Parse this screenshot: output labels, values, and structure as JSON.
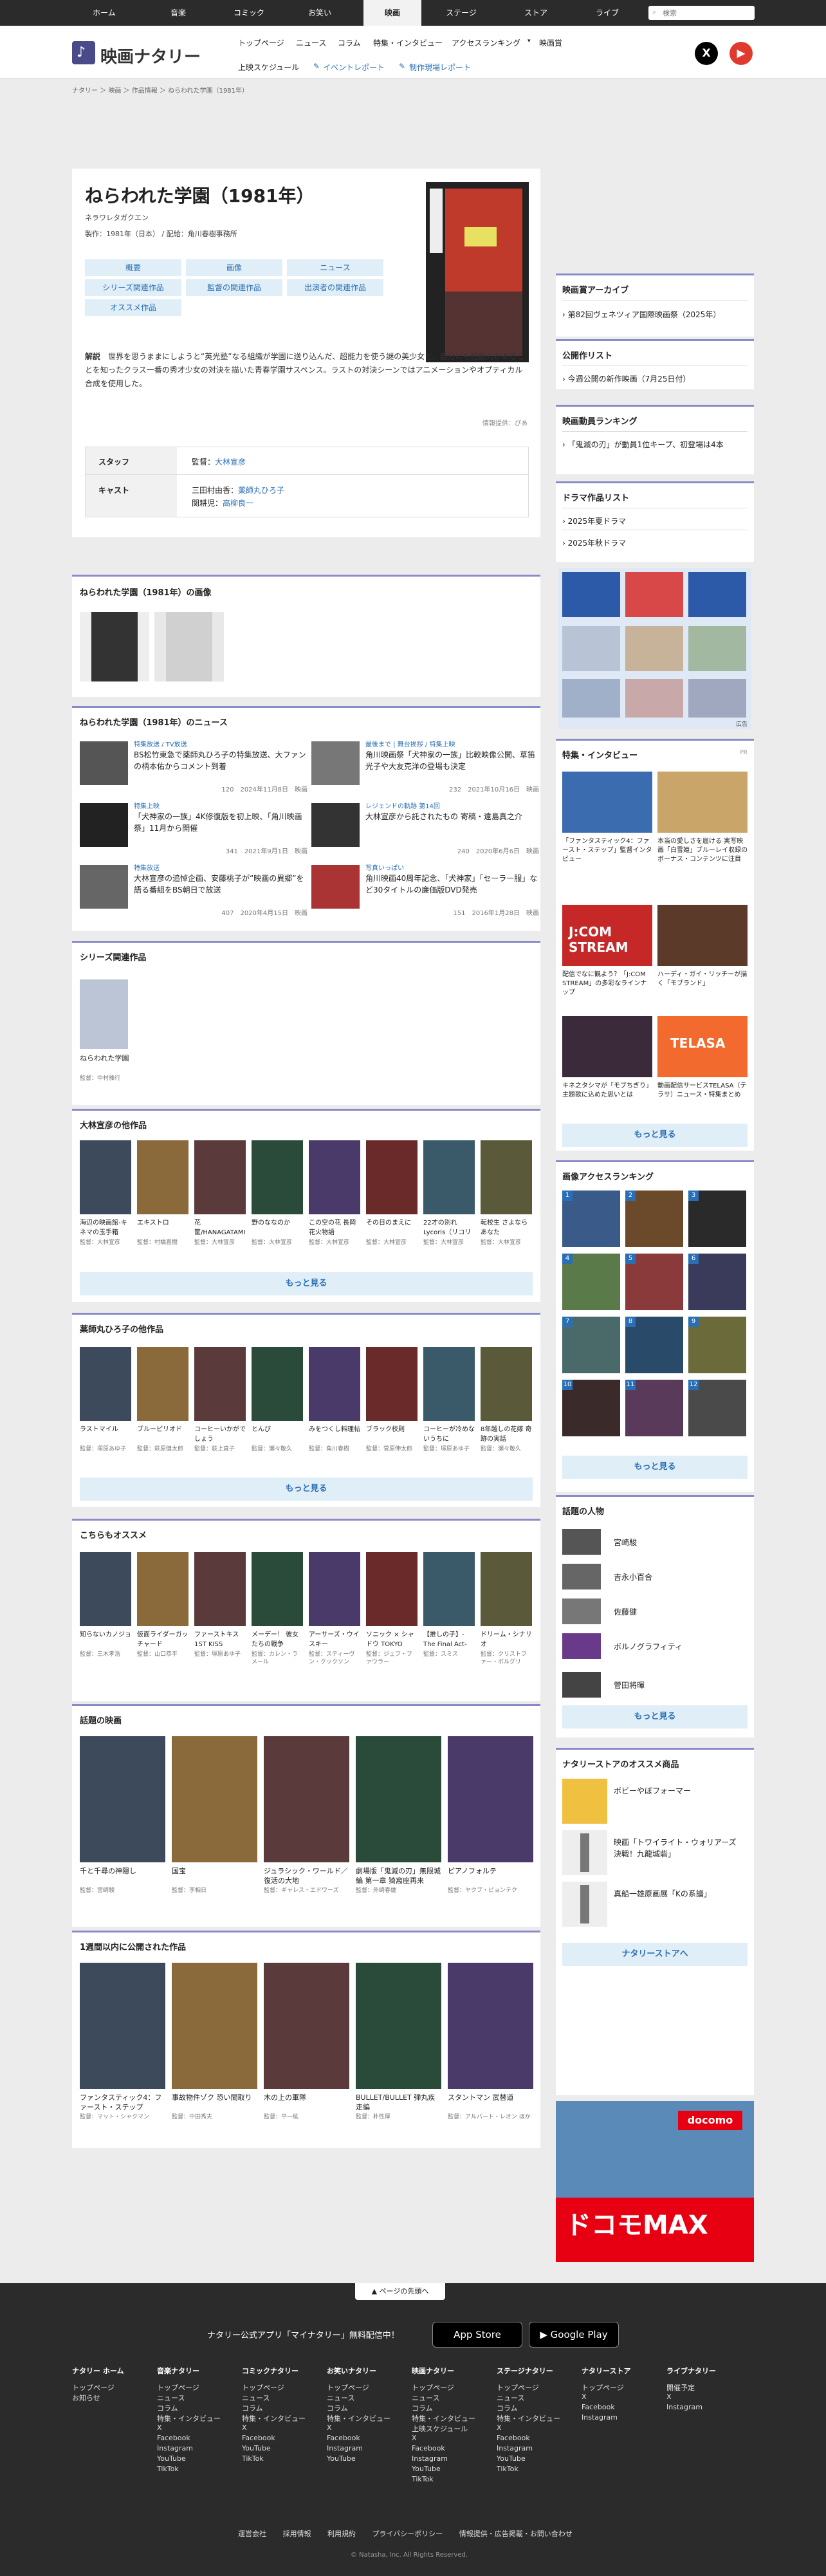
{
  "topnav": {
    "tabs": [
      "ホーム",
      "音楽",
      "コミック",
      "お笑い",
      "映画",
      "ステージ",
      "ストア",
      "ライブ"
    ],
    "active": "映画",
    "search_placeholder": "検索"
  },
  "header": {
    "logo_text": "映画ナタリー",
    "nav": [
      "トップページ",
      "ニュース",
      "コラム",
      "特集・インタビュー",
      "アクセスランキング",
      "映画賞",
      "上映スケジュール",
      "イベントレポート",
      "制作現場レポート"
    ]
  },
  "breadcrumb": [
    "ナタリー",
    "映画",
    "作品情報",
    "ねらわれた学園（1981年）"
  ],
  "movie": {
    "title": "ねらわれた学園（1981年）",
    "kana": "ネラワレタガクエン",
    "meta": "製作：1981年（日本） / 配給：角川春樹事務所",
    "buttons": [
      "概要",
      "画像",
      "ニュース",
      "シリーズ関連作品",
      "監督の関連作品",
      "出演者の関連作品",
      "オススメ作品"
    ],
    "desc_label": "解説",
    "desc": "世界を思うままにしようと“英光塾”なる組織が学園に送り込んだ、超能力を使う謎の美少女と、自分にも超能力があることを知ったクラス一番の秀才少女の対決を描いた青春学園サスペンス。ラストの対決シーンではアニメーションやオプティカル合成を使用した。",
    "source": "情報提供：ぴあ",
    "staff_label": "スタッフ",
    "director_prefix": "監督：",
    "director": "大林宣彦",
    "cast_label": "キャスト",
    "cast": [
      {
        "role": "三田村由香：",
        "name": "薬師丸ひろ子"
      },
      {
        "role": "関耕児：",
        "name": "高柳良一"
      }
    ]
  },
  "images_section": {
    "title": "ねらわれた学園（1981年）の画像"
  },
  "news_section": {
    "title": "ねらわれた学園（1981年）のニュース",
    "items": [
      {
        "cat": "特集放送 / TV放送",
        "title": "BS松竹東急で薬師丸ひろ子の特集放送、大ファンの柄本佑からコメント到着",
        "meta": "120　2024年11月8日　映画"
      },
      {
        "cat": "最後まで | 舞台挨拶 / 特集上映",
        "title": "角川映画祭「犬神家の一族」比較映像公開、草笛光子や大友克洋の登場も決定",
        "meta": "232　2021年10月16日　映画"
      },
      {
        "cat": "特集上映",
        "title": "「犬神家の一族」4K修復版を初上映、「角川映画祭」11月から開催",
        "meta": "341　2021年9月1日　映画"
      },
      {
        "cat": "レジェンドの軌跡 第14回",
        "title": "大林宣彦から託されたもの 寄稿・遠島真之介",
        "meta": "240　2020年6月6日　映画"
      },
      {
        "cat": "特集放送",
        "title": "大林宣彦の追悼企画、安藤桃子が“映画の異郷”を語る番組をBS朝日で放送",
        "meta": "407　2020年4月15日　映画"
      },
      {
        "cat": "写真いっぱい",
        "title": "角川映画40周年記念、「犬神家」「セーラー服」など30タイトルの廉価版DVD発売",
        "meta": "151　2016年1月28日　映画"
      }
    ]
  },
  "series_section": {
    "title": "シリーズ関連作品",
    "items": [
      {
        "title": "ねらわれた学園",
        "sub": "監督：中村雅行"
      }
    ]
  },
  "director_section": {
    "title": "大林宣彦の他作品",
    "items": [
      {
        "title": "海辺の映画館-キネマの玉手箱",
        "sub": "監督：大林宣彦"
      },
      {
        "title": "エキストロ",
        "sub": "監督：村橋直樹"
      },
      {
        "title": "花筐/HANAGATAMI",
        "sub": "監督：大林宣彦"
      },
      {
        "title": "野のななのか",
        "sub": "監督：大林宣彦"
      },
      {
        "title": "この空の花 長岡花火物語",
        "sub": "監督：大林宣彦"
      },
      {
        "title": "その日のまえに",
        "sub": "監督：大林宣彦"
      },
      {
        "title": "22才の別れ Lycoris（リコリス）葉見ず花見ず物語",
        "sub": "監督：大林宣彦"
      },
      {
        "title": "転校生 さよならあなた",
        "sub": "監督：大林宣彦"
      }
    ],
    "more": "もっと見る"
  },
  "actor_section": {
    "title": "薬師丸ひろ子の他作品",
    "items": [
      {
        "title": "ラストマイル",
        "sub": "監督：塚原あゆ子"
      },
      {
        "title": "ブルーピリオド",
        "sub": "監督：萩原健太郎"
      },
      {
        "title": "コーヒーいかがでしょう",
        "sub": "監督：荻上直子"
      },
      {
        "title": "とんび",
        "sub": "監督：瀬々敬久"
      },
      {
        "title": "みをつくし料理帖",
        "sub": "監督：角川春樹"
      },
      {
        "title": "ブラック校則",
        "sub": "監督：菅原伸太郎"
      },
      {
        "title": "コーヒーが冷めないうちに",
        "sub": "監督：塚原あゆ子"
      },
      {
        "title": "8年越しの花嫁 奇跡の実話",
        "sub": "監督：瀬々敬久"
      }
    ],
    "more": "もっと見る"
  },
  "recommend_section": {
    "title": "こちらもオススメ",
    "items": [
      {
        "title": "知らないカノジョ",
        "sub": "監督：三木孝浩"
      },
      {
        "title": "仮面ライダーガッチャード GRADUATIONS",
        "sub": "監督：山口恭平"
      },
      {
        "title": "ファーストキス 1ST KISS",
        "sub": "監督：塚原あゆ子"
      },
      {
        "title": "メーデー！ 彼女たちの戦争",
        "sub": "監督：カレン・ラメール"
      },
      {
        "title": "アーサーズ・ウイスキー",
        "sub": "監督：スティーヴン・クックソン"
      },
      {
        "title": "ソニック × シャドウ TOKYO MISSION",
        "sub": "監督：ジェフ・ファウラー"
      },
      {
        "title": "【推しの子】-The Final Act-",
        "sub": "監督：スミス"
      },
      {
        "title": "ドリーム・シナリオ",
        "sub": "監督：クリストファー・ボルグリ"
      }
    ]
  },
  "hot_section": {
    "title": "話題の映画",
    "items": [
      {
        "title": "千と千尋の神隠し",
        "sub": "監督：宮崎駿"
      },
      {
        "title": "国宝",
        "sub": "監督：李相日"
      },
      {
        "title": "ジュラシック・ワールド／復活の大地",
        "sub": "監督：ギャレス・エドワーズ"
      },
      {
        "title": "劇場版「鬼滅の刃」無限城編 第一章 猗窩座再来",
        "sub": "監督：外崎春雄"
      },
      {
        "title": "ピアノフォルテ",
        "sub": "監督：ヤクブ・ピョンテク"
      }
    ]
  },
  "week_section": {
    "title": "1週間以内に公開された作品",
    "items": [
      {
        "title": "ファンタスティック4：ファースト・ステップ",
        "sub": "監督：マット・シャクマン"
      },
      {
        "title": "事故物件ゾク 恐い間取り",
        "sub": "監督：中田秀夫"
      },
      {
        "title": "木の上の軍隊",
        "sub": "監督：平一紘"
      },
      {
        "title": "BULLET/BULLET 弾丸疾走編",
        "sub": "監督：朴性厚"
      },
      {
        "title": "スタントマン 武替道",
        "sub": "監督：アルバート・レオン ほか"
      }
    ]
  },
  "sidebar": {
    "award": {
      "title": "映画賞アーカイブ",
      "items": [
        "第82回ヴェネツィア国際映画祭（2025年）"
      ]
    },
    "release": {
      "title": "公開作リスト",
      "items": [
        "今週公開の新作映画（7月25日付）"
      ]
    },
    "ranking": {
      "title": "映画動員ランキング",
      "items": [
        "「鬼滅の刃」が動員1位キープ、初登場は4本"
      ]
    },
    "drama": {
      "title": "ドラマ作品リスト",
      "items": [
        "2025年夏ドラマ",
        "2025年秋ドラマ"
      ]
    },
    "ad_note": "広告",
    "features": {
      "title": "特集・インタビュー",
      "pr": "PR",
      "items": [
        "「ファンタスティック4：ファースト・ステップ」監督インタビュー",
        "本当の愛しさを届ける 実写映画「白雪姫」ブルーレイ収録のボーナス・コンテンツに注目",
        "配信でなに観よう？「J:COM STREAM」の多彩なラインナップ",
        "ハーディ・ガイ・リッチーが描く「モブランド」",
        "キネ之タシマが「モブちぎり」主題歌に込めた思いとは",
        "動画配信サービスTELASA（テラサ）ニュース・特集まとめ"
      ],
      "more": "もっと見る"
    },
    "image_ranking": {
      "title": "画像アクセスランキング",
      "more": "もっと見る"
    },
    "people": {
      "title": "話題の人物",
      "items": [
        "宮崎駿",
        "吉永小百合",
        "佐藤健",
        "ボルノグラフィティ",
        "菅田将暉"
      ],
      "more": "もっと見る"
    },
    "store": {
      "title": "ナタリーストアのオススメ商品",
      "items": [
        "ボビーやぼフォーマー",
        "映画「トワイライト・ウォリアーズ 決戦！九龍城砦」",
        "真船一雄原画展「Kの系譜」"
      ],
      "more": "ナタリーストアへ"
    }
  },
  "footer": {
    "back_to_top": "ページの先頭へ",
    "app_text": "ナタリー公式アプリ「マイナタリー」無料配信中！",
    "app_store": "App Store",
    "google_play": "Google Play",
    "columns": [
      {
        "title": "ナタリー ホーム",
        "items": [
          "トップページ",
          "お知らせ"
        ]
      },
      {
        "title": "音楽ナタリー",
        "items": [
          "トップページ",
          "ニュース",
          "コラム",
          "特集・インタビュー",
          "X",
          "Facebook",
          "Instagram",
          "YouTube",
          "TikTok"
        ]
      },
      {
        "title": "コミックナタリー",
        "items": [
          "トップページ",
          "ニュース",
          "コラム",
          "特集・インタビュー",
          "X",
          "Facebook",
          "YouTube",
          "TikTok"
        ]
      },
      {
        "title": "お笑いナタリー",
        "items": [
          "トップページ",
          "ニュース",
          "コラム",
          "特集・インタビュー",
          "X",
          "Facebook",
          "Instagram",
          "YouTube"
        ]
      },
      {
        "title": "映画ナタリー",
        "items": [
          "トップページ",
          "ニュース",
          "コラム",
          "特集・インタビュー",
          "上映スケジュール",
          "X",
          "Facebook",
          "Instagram",
          "YouTube",
          "TikTok"
        ]
      },
      {
        "title": "ステージナタリー",
        "items": [
          "トップページ",
          "ニュース",
          "コラム",
          "特集・インタビュー",
          "X",
          "Facebook",
          "Instagram",
          "YouTube",
          "TikTok"
        ]
      },
      {
        "title": "ナタリーストア",
        "items": [
          "トップページ",
          "X",
          "Facebook",
          "Instagram"
        ]
      },
      {
        "title": "ライブナタリー",
        "items": [
          "開催予定",
          "X",
          "Instagram"
        ]
      }
    ],
    "links": [
      "運営会社",
      "採用情報",
      "利用規約",
      "プライバシーポリシー",
      "情報提供・広告掲載・お問い合わせ"
    ],
    "copyright": "© Natasha, Inc. All Rights Reserved."
  },
  "colors": {
    "accent": "#2a6fb5",
    "section_line": "#8a8ac9",
    "header_dark": "#2b2b2b"
  }
}
